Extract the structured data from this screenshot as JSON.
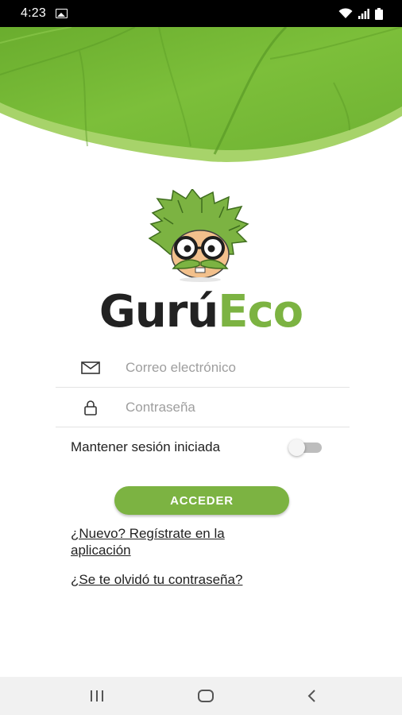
{
  "status_bar": {
    "time": "4:23",
    "icons": [
      "gallery-icon",
      "wifi-icon",
      "signal-icon",
      "battery-icon"
    ]
  },
  "header": {
    "decoration": "green-leaf-banner"
  },
  "brand": {
    "part1": "Gurú",
    "part2": "Eco",
    "colors": {
      "dark": "#222222",
      "accent": "#7cb342"
    }
  },
  "form": {
    "email": {
      "icon": "mail-icon",
      "placeholder": "Correo electrónico",
      "value": ""
    },
    "password": {
      "icon": "lock-icon",
      "placeholder": "Contraseña",
      "value": ""
    },
    "keep_session": {
      "label": "Mantener sesión iniciada",
      "checked": false
    },
    "submit_label": "ACCEDER"
  },
  "links": {
    "register": "¿Nuevo? Regístrate en la aplicación",
    "forgot": "¿Se te olvidó tu contraseña?"
  },
  "nav_bar": {
    "icons": [
      "recent-apps-icon",
      "home-icon",
      "back-icon"
    ]
  }
}
